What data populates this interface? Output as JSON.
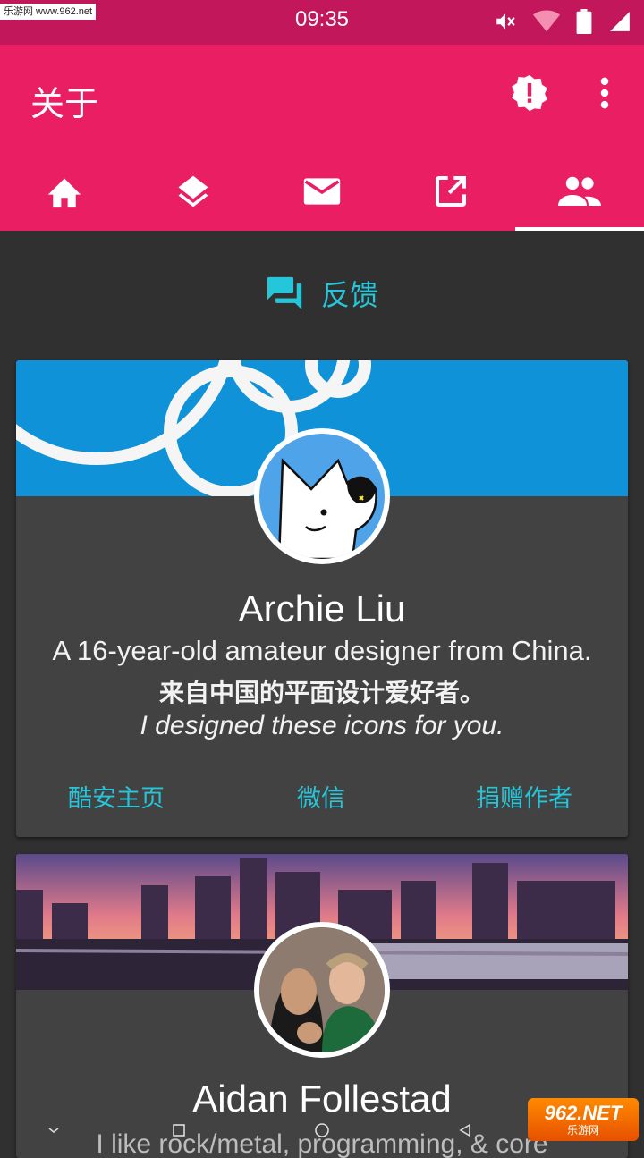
{
  "status_bar": {
    "time": "09:35",
    "watermark": "乐游网 www.962.net",
    "icons": [
      "mute-icon",
      "wifi-icon",
      "battery-icon",
      "signal-icon"
    ]
  },
  "app_bar": {
    "title": "关于",
    "actions": [
      "feedback-alert-icon",
      "more-vert-icon"
    ],
    "tabs": [
      {
        "icon": "home-icon",
        "active": false
      },
      {
        "icon": "layers-icon",
        "active": false
      },
      {
        "icon": "mail-icon",
        "active": false
      },
      {
        "icon": "open-in-new-icon",
        "active": false
      },
      {
        "icon": "people-icon",
        "active": true
      }
    ]
  },
  "feedback": {
    "icon": "forum-icon",
    "label": "反馈"
  },
  "cards": [
    {
      "name": "Archie Liu",
      "bio_en": "A 16-year-old amateur designer from China.",
      "bio_zh": "来自中国的平面设计爱好者。",
      "tagline": "I designed these icons for you.",
      "links": [
        "酷安主页",
        "微信",
        "捐赠作者"
      ]
    },
    {
      "name": "Aidan Follestad",
      "bio_en": "I like rock/metal, programming, & core"
    }
  ],
  "nav_bar": {
    "buttons": [
      "collapse-icon",
      "recents-icon",
      "home-circle-icon",
      "back-icon"
    ]
  },
  "watermark_bottom": {
    "big": "962.NET",
    "small": "乐游网"
  },
  "colors": {
    "primary": "#e91e63",
    "status": "#c2185b",
    "accent": "#26c6da",
    "background": "#303030",
    "card": "#424242"
  }
}
